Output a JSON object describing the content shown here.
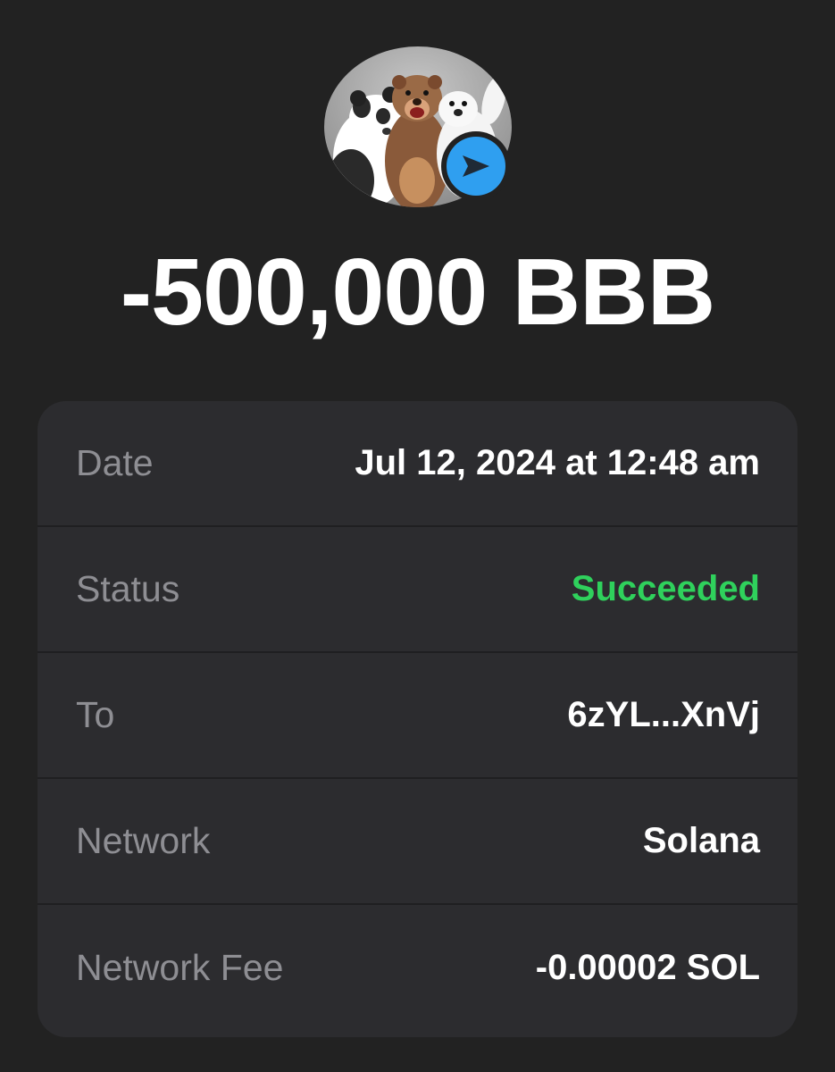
{
  "transaction": {
    "amount": "-500,000 BBB",
    "avatar": "token-avatar-bears",
    "badge_icon": "send-arrow-icon",
    "badge_color": "#2f9ff0"
  },
  "details": {
    "rows": [
      {
        "label": "Date",
        "value": "Jul 12, 2024 at 12:48 am"
      },
      {
        "label": "Status",
        "value": "Succeeded"
      },
      {
        "label": "To",
        "value": "6zYL...XnVj"
      },
      {
        "label": "Network",
        "value": "Solana"
      },
      {
        "label": "Network Fee",
        "value": "-0.00002 SOL"
      }
    ]
  },
  "colors": {
    "background": "#222222",
    "card": "#2c2c2f",
    "label": "#8e8e93",
    "value": "#ffffff",
    "success": "#2fd15c"
  }
}
